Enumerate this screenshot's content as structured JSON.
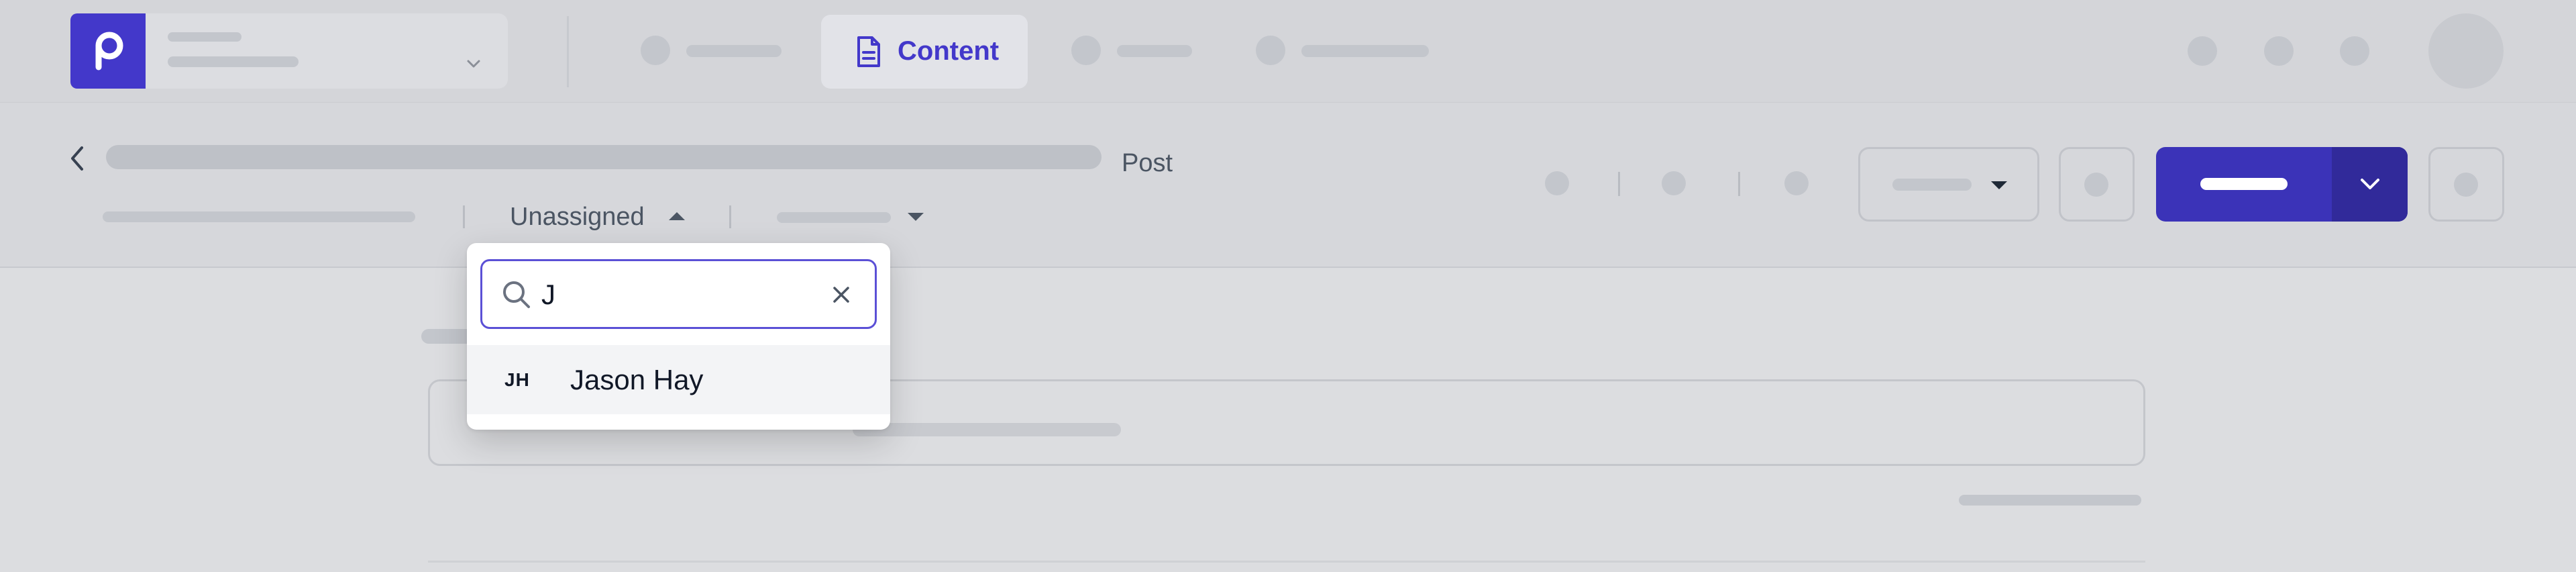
{
  "nav": {
    "content_tab_label": "Content"
  },
  "post_header": {
    "type_label": "Post",
    "assignee_value": "Unassigned"
  },
  "assignee_dropdown": {
    "search_value": "J",
    "options": [
      {
        "initials": "JH",
        "name": "Jason Hay"
      }
    ]
  },
  "colors": {
    "brand": "#4338ca",
    "focus_border": "#5b50d6",
    "publish_button": "#3b33b8"
  }
}
